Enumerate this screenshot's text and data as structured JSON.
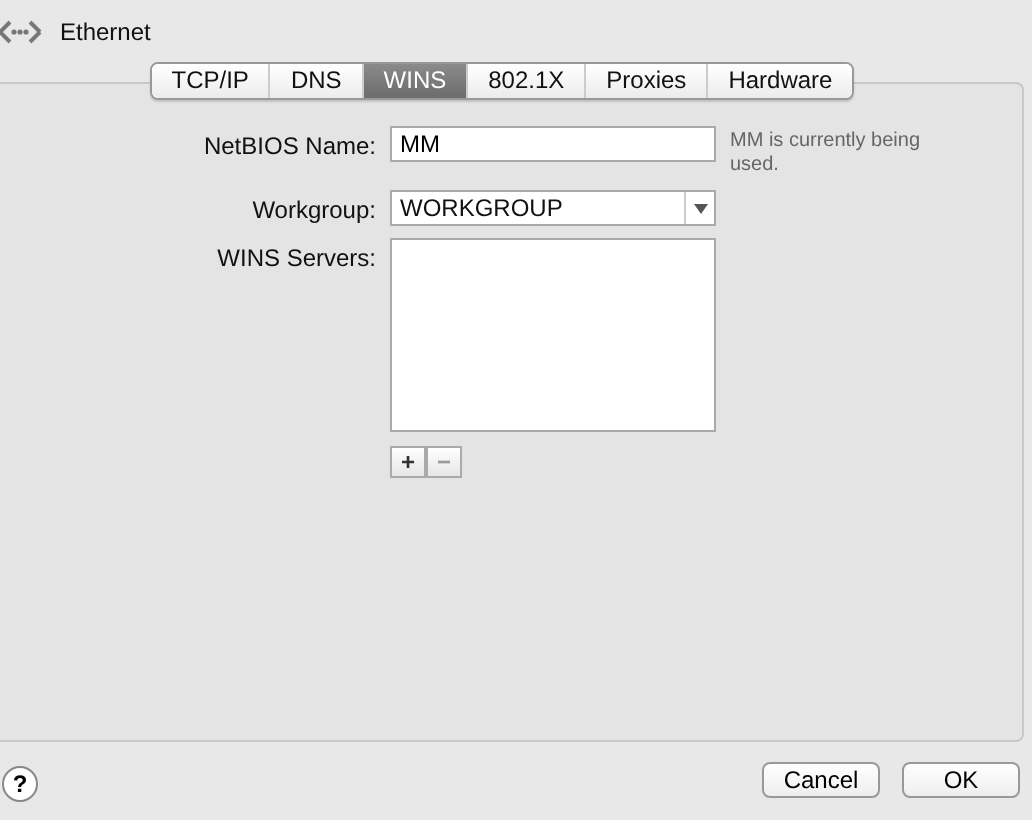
{
  "window": {
    "title": "Ethernet"
  },
  "tabs": [
    {
      "label": "TCP/IP",
      "selected": false
    },
    {
      "label": "DNS",
      "selected": false
    },
    {
      "label": "WINS",
      "selected": true
    },
    {
      "label": "802.1X",
      "selected": false
    },
    {
      "label": "Proxies",
      "selected": false
    },
    {
      "label": "Hardware",
      "selected": false
    }
  ],
  "netbios_name": {
    "label": "NetBIOS Name:",
    "value": "MM",
    "note": "MM is currently being used."
  },
  "workgroup": {
    "label": "Workgroup:",
    "value": "WORKGROUP"
  },
  "wins_servers": {
    "label": "WINS Servers:",
    "add": "+",
    "remove": "−"
  },
  "buttons": [
    {
      "label": "Cancel",
      "default": false
    },
    {
      "label": "OK",
      "default": false
    }
  ],
  "help": "?"
}
